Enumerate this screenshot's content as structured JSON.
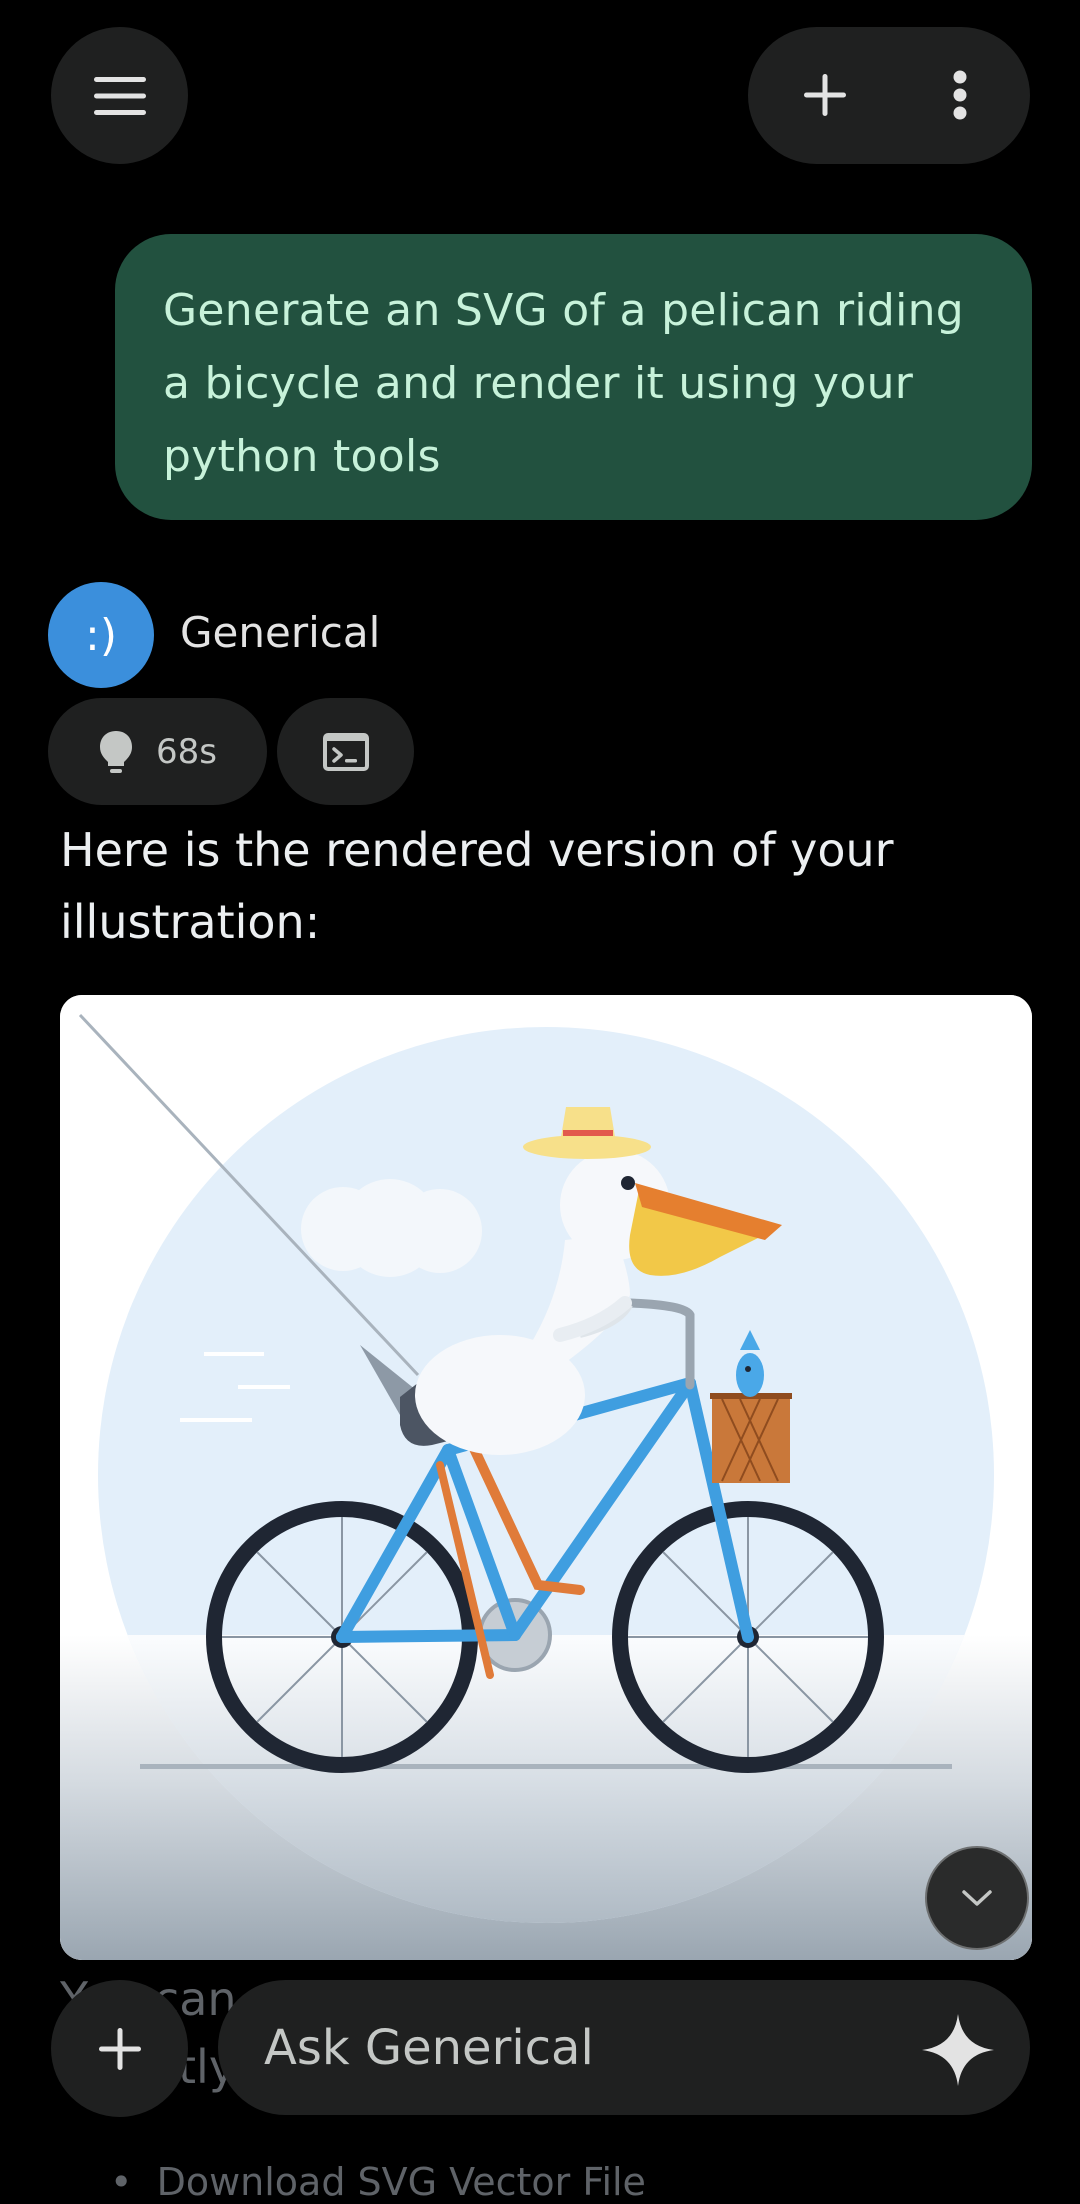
{
  "header": {
    "menu_icon": "hamburger-menu-icon",
    "new_chat_icon": "plus-icon",
    "more_icon": "more-vert-icon"
  },
  "user_message": {
    "text": "Generate an SVG of a pelican riding a bicycle and render it using your python tools"
  },
  "assistant": {
    "avatar_text": ":)",
    "name": "Generical",
    "thinking_chip_label": "68s",
    "thinking_icon": "lightbulb-icon",
    "code_icon": "terminal-icon",
    "response_text": "Here is the rendered version of your illustration:",
    "followup_text_partial_1": "You can",
    "followup_text_partial_2": "tly",
    "followup_bullet_partial": "Download SVG Vector File"
  },
  "composer": {
    "add_icon": "plus-icon",
    "placeholder": "Ask Generical",
    "spark_icon": "sparkle-icon"
  },
  "scroll_button_icon": "chevron-down-icon",
  "colors": {
    "background": "#000000",
    "surface": "#1f2020",
    "user_bubble": "#22513f",
    "user_text": "#c7f2da",
    "avatar": "#3b8fdc"
  }
}
